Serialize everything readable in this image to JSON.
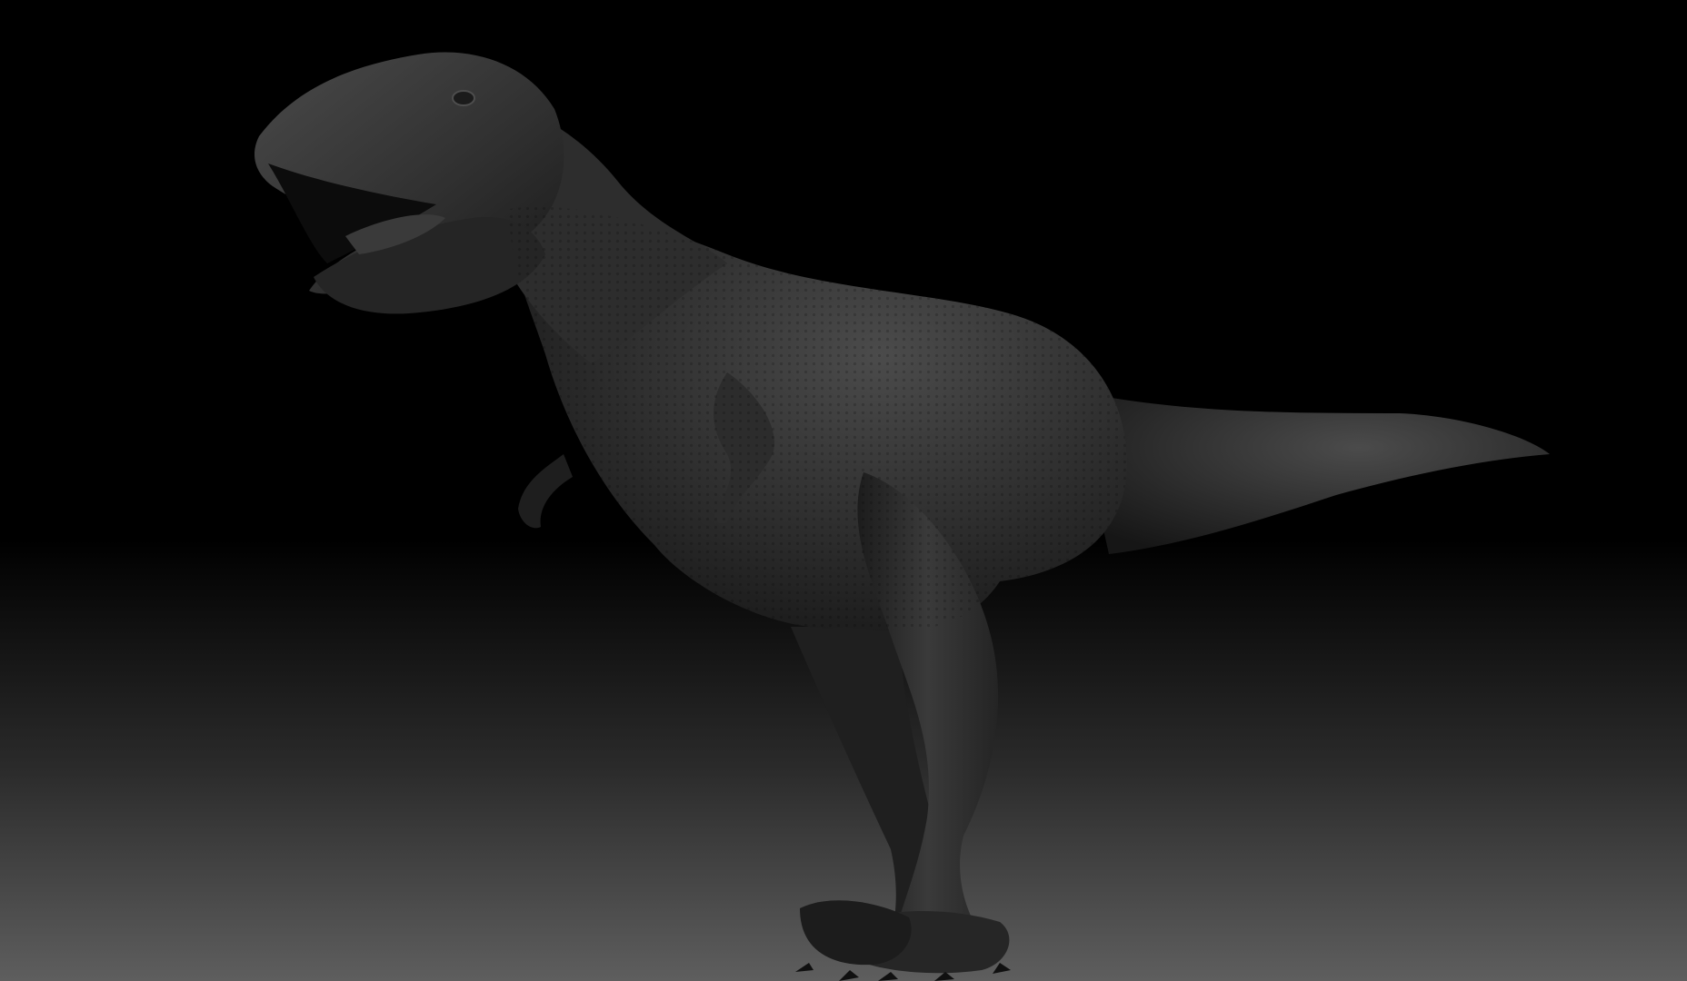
{
  "scene": {
    "subject": "t-rex-sculpt",
    "background": {
      "top_color": "#000000",
      "bottom_color": "#5e5e5e"
    },
    "material": {
      "base_color": "#2f2f2f",
      "highlight_color": "#5a5a5a",
      "shadow_color": "#141414"
    }
  }
}
